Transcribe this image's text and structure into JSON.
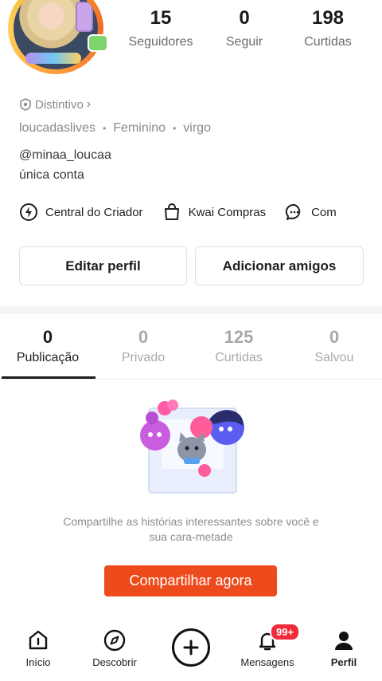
{
  "profile": {
    "stats": [
      {
        "value": "15",
        "label": "Seguidores"
      },
      {
        "value": "0",
        "label": "Seguir"
      },
      {
        "value": "198",
        "label": "Curtidas"
      }
    ],
    "badge_label": "Distintivo",
    "tags": [
      "loucadaslives",
      "Feminino",
      "virgo"
    ],
    "handle": "@minaa_loucaa",
    "bio": "única conta"
  },
  "shortcuts": [
    {
      "label": "Central do Criador",
      "icon": "bolt-icon"
    },
    {
      "label": "Kwai Compras",
      "icon": "shopping-bag-icon"
    },
    {
      "label": "Com",
      "icon": "chat-bubble-icon"
    }
  ],
  "buttons": {
    "edit": "Editar perfil",
    "add_friends": "Adicionar amigos"
  },
  "tabs": [
    {
      "count": "0",
      "label": "Publicação",
      "active": true
    },
    {
      "count": "0",
      "label": "Privado"
    },
    {
      "count": "125",
      "label": "Curtidas"
    },
    {
      "count": "0",
      "label": "Salvou"
    }
  ],
  "empty_state": {
    "line1": "Compartilhe as histórias interessantes sobre você e",
    "line2": "sua cara-metade",
    "button": "Compartilhar agora"
  },
  "bottom_nav": {
    "home": "Início",
    "discover": "Descobrir",
    "messages": "Mensagens",
    "messages_badge": "99+",
    "profile": "Perfil"
  },
  "colors": {
    "accent": "#ee4b1c",
    "badge": "#ee2a3b"
  }
}
